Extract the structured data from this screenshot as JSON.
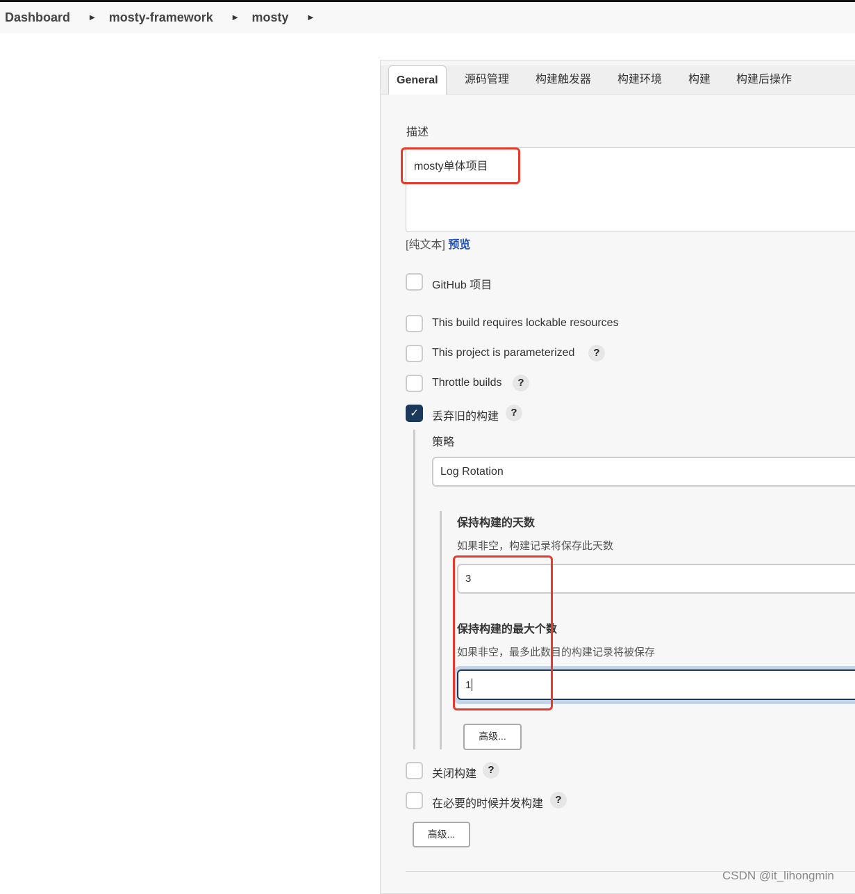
{
  "breadcrumb": [
    "Dashboard",
    "mosty-framework",
    "mosty"
  ],
  "tabs": [
    "General",
    "源码管理",
    "构建触发器",
    "构建环境",
    "构建",
    "构建后操作"
  ],
  "description": {
    "label": "描述",
    "value": "mosty单体项目",
    "plain_text": "[纯文本]",
    "preview": "预览"
  },
  "options": [
    {
      "label": "GitHub 项目",
      "checked": false
    },
    {
      "label": "This build requires lockable resources",
      "checked": false
    },
    {
      "label": "This project is parameterized",
      "checked": false
    },
    {
      "label": "Throttle builds",
      "checked": false
    },
    {
      "label": "丢弃旧的构建",
      "checked": true
    },
    {
      "label": "关闭构建",
      "checked": false
    },
    {
      "label": "在必要的时候并发构建",
      "checked": false
    }
  ],
  "help": "?",
  "strategy": {
    "label": "策略",
    "value": "Log Rotation",
    "days_label": "保持构建的天数",
    "days_hint": "如果非空，构建记录将保存此天数",
    "days_value": "3",
    "max_label": "保持构建的最大个数",
    "max_hint": "如果非空，最多此数目的构建记录将被保存",
    "max_value": "1",
    "advanced": "高级..."
  },
  "advanced": "高级...",
  "watermark": "CSDN @it_lihongmin",
  "colors": {
    "annotation": "#e53b2c",
    "checkbox": "#1b3a5b",
    "link": "#1d4fb8"
  }
}
